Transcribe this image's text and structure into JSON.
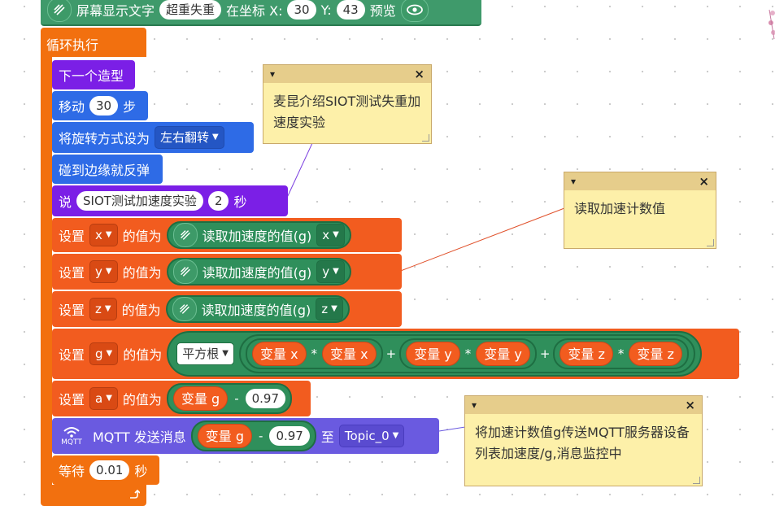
{
  "colors": {
    "loop": "#f2700f",
    "looks": "#7b1fe6",
    "motion": "#2e6be6",
    "variables": "#f25c1f",
    "sensor": "#2f8f5b",
    "mqtt": "#6a5ae0",
    "comment_bg": "#fdf0a9",
    "comment_header": "#e6cd8b"
  },
  "top_block": {
    "icon": "accelerometer-icon",
    "label": "屏幕显示文字",
    "text": "超重失重",
    "at_label": "在坐标 X:",
    "x": "30",
    "y_label": "Y:",
    "y": "43",
    "preview_label": "预览",
    "eye_icon": "eye-icon"
  },
  "loop": {
    "label": "循环执行",
    "end_icon": "loop-arrow-icon"
  },
  "blocks": {
    "next_costume": "下一个造型",
    "move_label": "移动",
    "move_steps": "30",
    "move_unit": "步",
    "rotation_label": "将旋转方式设为",
    "rotation_value": "左右翻转",
    "bounce": "碰到边缘就反弹",
    "say_label": "说",
    "say_text": "SIOT测试加速度实验",
    "say_secs": "2",
    "say_unit": "秒",
    "set_label": "设置",
    "value_label": "的值为",
    "read_accel": "读取加速度的值(g)",
    "set_x": {
      "var": "x",
      "axis": "x"
    },
    "set_y": {
      "var": "y",
      "axis": "y"
    },
    "set_z": {
      "var": "z",
      "axis": "z"
    },
    "set_g": {
      "var": "g",
      "sqrt_label": "平方根",
      "var_x": "变量 x",
      "var_y": "变量 y",
      "var_z": "变量 z",
      "times": "*",
      "plus": "+"
    },
    "set_a": {
      "var": "a",
      "operand": "变量 g",
      "minus": "-",
      "value": "0.97"
    },
    "mqtt": {
      "icon_label": "MQTT",
      "label": "MQTT 发送消息",
      "operand": "变量 g",
      "minus": "-",
      "value": "0.97",
      "to_label": "至",
      "topic": "Topic_0"
    },
    "wait_label": "等待",
    "wait_value": "0.01",
    "wait_unit": "秒"
  },
  "comments": [
    {
      "text": "麦昆介绍SIOT测试失重加速度实验"
    },
    {
      "text": "读取加速计数值"
    },
    {
      "text": "将加速计数值g传送MQTT服务器设备列表加速度/g,消息监控中"
    }
  ],
  "comment_controls": {
    "collapse": "▾",
    "close": "×"
  }
}
